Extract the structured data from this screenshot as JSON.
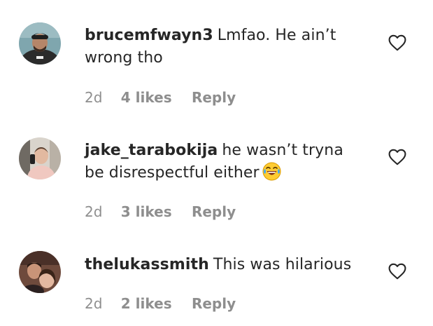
{
  "comments": [
    {
      "username": "brucemfwayn3",
      "text": "Lmfao. He ain’t wrong tho",
      "time": "2d",
      "likes": "4 likes",
      "reply": "Reply",
      "avatar_icon": "avatar-photo"
    },
    {
      "username": "jake_tarabokija",
      "text": "he wasn’t tryna be disrespectful either",
      "emoji": "face-with-tears-of-joy",
      "time": "2d",
      "likes": "3 likes",
      "reply": "Reply",
      "avatar_icon": "avatar-photo"
    },
    {
      "username": "thelukassmith",
      "text": "This was hilarious",
      "time": "2d",
      "likes": "2 likes",
      "reply": "Reply",
      "avatar_icon": "avatar-photo"
    }
  ],
  "icons": {
    "like": "heart-outline-icon"
  },
  "colors": {
    "text": "#262626",
    "meta": "#8e8e8e",
    "icon": "#262626"
  }
}
